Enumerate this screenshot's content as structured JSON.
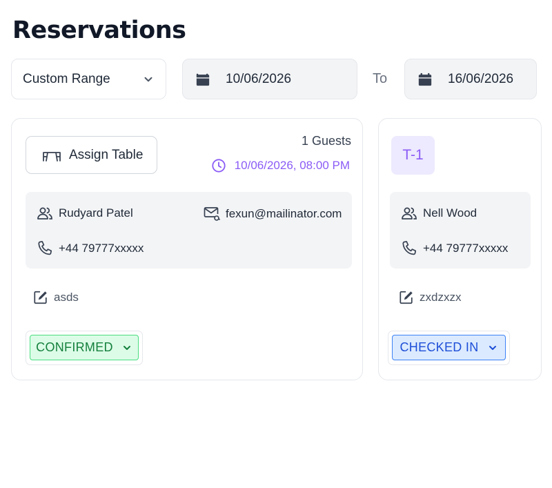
{
  "page": {
    "title": "Reservations"
  },
  "filters": {
    "range_select": {
      "value": "Custom Range"
    },
    "date_from": "10/06/2026",
    "to_label": "To",
    "date_to": "16/06/2026"
  },
  "reservations": [
    {
      "assign_label": "Assign Table",
      "guests": "1 Guests",
      "datetime": "10/06/2026, 08:00 PM",
      "name": "Rudyard Patel",
      "email": "fexun@mailinator.com",
      "phone": "+44 79777xxxxx",
      "note": "asds",
      "status": "CONFIRMED"
    },
    {
      "table": "T-1",
      "name": "Nell Wood",
      "phone": "+44 79777xxxxx",
      "note": "zxdzxzx",
      "status": "CHECKED IN"
    }
  ],
  "colors": {
    "accent_purple": "#8b5cf6",
    "confirmed_green": "#15803d",
    "checked_in_blue": "#1d4ed8"
  },
  "icons": [
    "chevron-down-icon",
    "calendar-icon",
    "table-icon",
    "clock-icon",
    "users-icon",
    "mail-icon",
    "phone-icon",
    "edit-icon"
  ]
}
